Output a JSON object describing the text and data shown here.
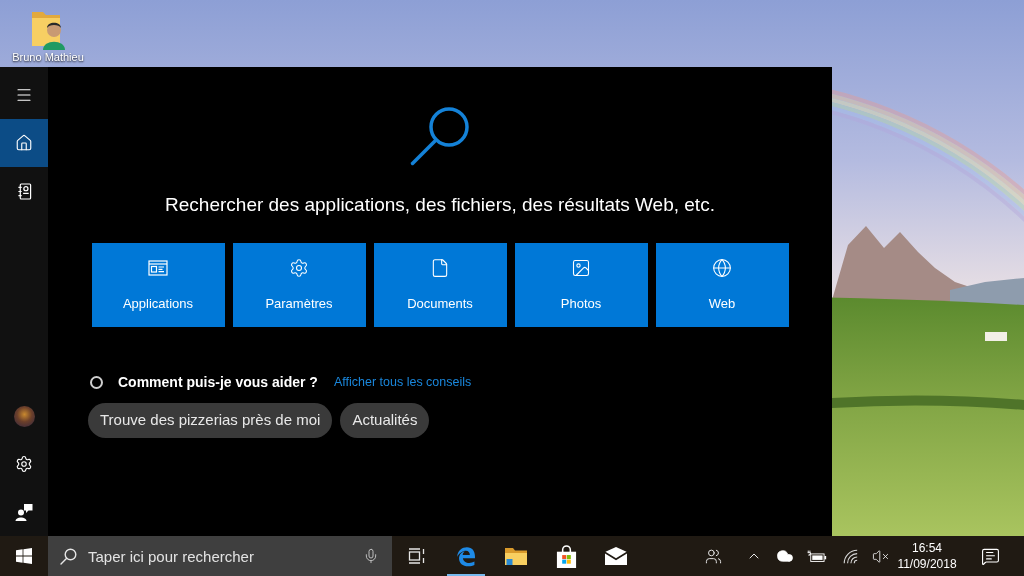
{
  "desktop": {
    "shortcuts": [
      {
        "label": "Bruno Mathieu"
      }
    ]
  },
  "search_panel": {
    "sidebar": {
      "items": [
        {
          "selected": true
        },
        {
          "selected": false
        }
      ]
    },
    "prompt": "Rechercher des applications, des fichiers, des résultats Web, etc.",
    "categories": [
      {
        "label": "Applications"
      },
      {
        "label": "Paramètres"
      },
      {
        "label": "Documents"
      },
      {
        "label": "Photos"
      },
      {
        "label": "Web"
      }
    ],
    "help": {
      "title": "Comment puis-je vous aider ?",
      "link": "Afficher tous les conseils"
    },
    "suggestions": [
      {
        "label": "Trouve des pizzerias près de moi"
      },
      {
        "label": "Actualités"
      }
    ]
  },
  "taskbar": {
    "search": {
      "placeholder": "Taper ici pour rechercher"
    },
    "apps": [
      {
        "running": true
      },
      {
        "running": false
      },
      {
        "running": false
      },
      {
        "running": false
      }
    ],
    "tray": {
      "volume_muted": true,
      "time": "16:54",
      "date": "11/09/2018"
    }
  }
}
